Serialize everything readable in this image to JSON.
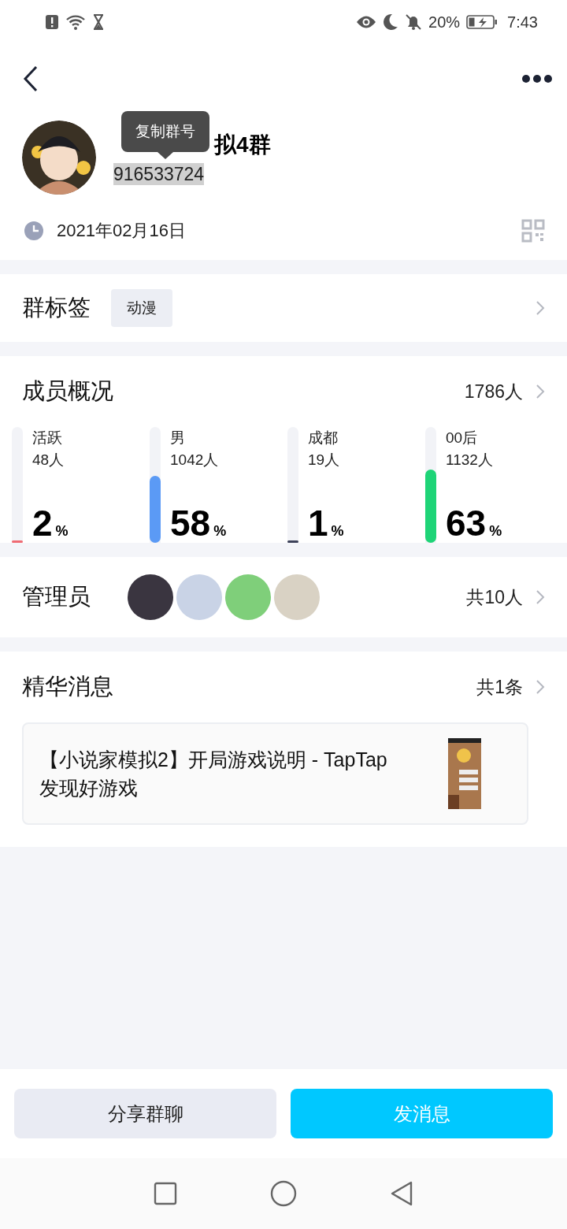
{
  "status_bar": {
    "battery": "20%",
    "time": "7:43"
  },
  "group": {
    "name": "拟4群",
    "number": "916533724",
    "tooltip": "复制群号",
    "date": "2021年02月16日"
  },
  "tag_section": {
    "title": "群标签",
    "tags": [
      "动漫"
    ]
  },
  "members": {
    "title": "成员概况",
    "total": "1786人",
    "stats": [
      {
        "label": "活跃",
        "count": "48人",
        "percent": "2",
        "unit": "%",
        "level": 0.02,
        "color": "#f06b73"
      },
      {
        "label": "男",
        "count": "1042人",
        "percent": "58",
        "unit": "%",
        "level": 0.58,
        "color": "#5b9af5"
      },
      {
        "label": "成都",
        "count": "19人",
        "percent": "1",
        "unit": "%",
        "level": 0.01,
        "color": "#3d4259"
      },
      {
        "label": "00后",
        "count": "1132人",
        "percent": "63",
        "unit": "%",
        "level": 0.63,
        "color": "#1ed477"
      }
    ]
  },
  "admins": {
    "title": "管理员",
    "avatars": [
      {
        "color": "#3a3540"
      },
      {
        "color": "#c9d3e6"
      },
      {
        "color": "#7fcf7a"
      },
      {
        "color": "#d9d2c4"
      }
    ],
    "count": "共10人"
  },
  "essence": {
    "title": "精华消息",
    "count": "共1条",
    "message": "【小说家模拟2】开局游戏说明 - TapTap 发现好游戏"
  },
  "buttons": [
    {
      "label": "分享群聊",
      "kind": "secondary"
    },
    {
      "label": "发消息",
      "kind": "primary"
    }
  ]
}
